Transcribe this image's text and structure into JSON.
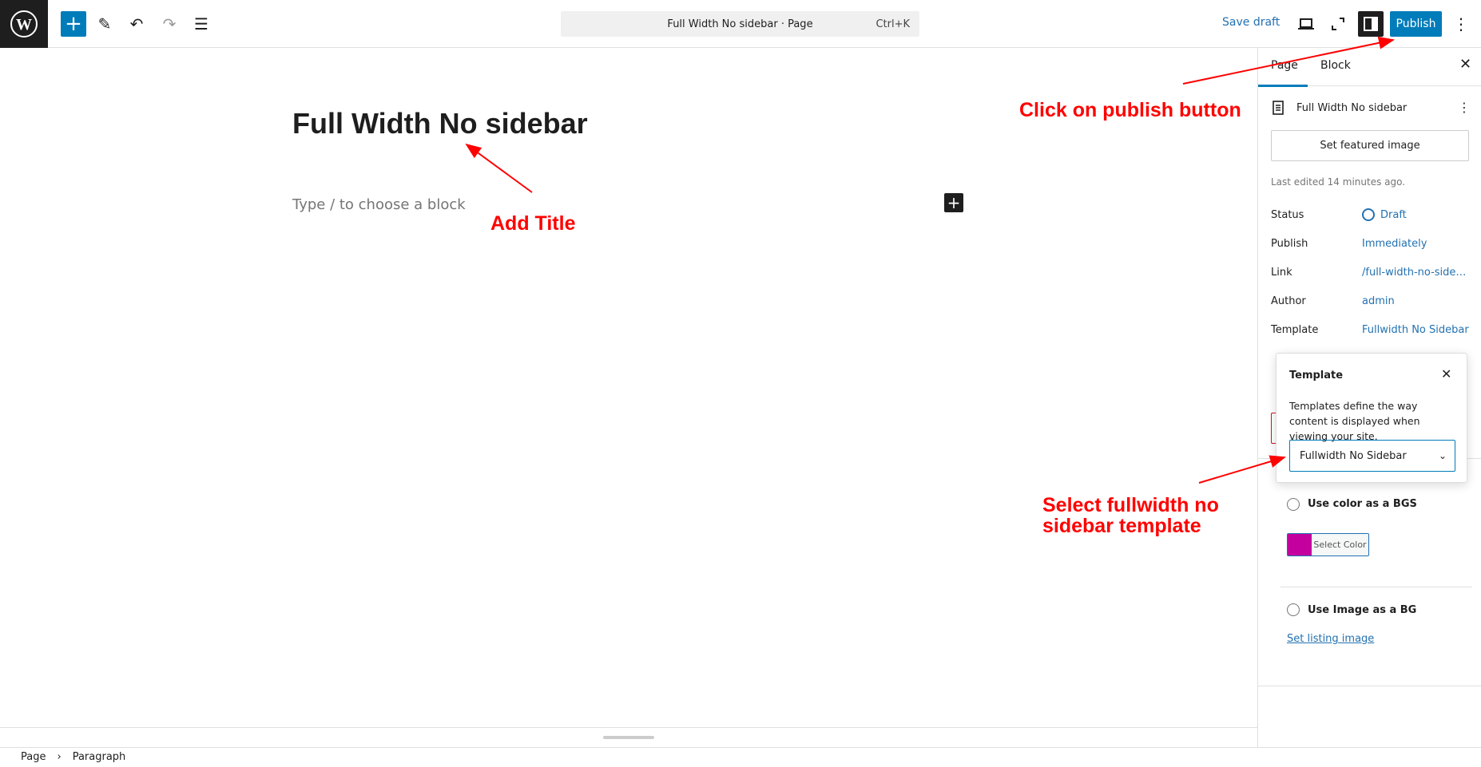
{
  "toolbar": {
    "command_bar": "Full Width No sidebar · Page",
    "shortcut": "Ctrl+K",
    "save_draft": "Save draft",
    "publish": "Publish"
  },
  "editor": {
    "title": "Full Width No sidebar",
    "placeholder": "Type / to choose a block"
  },
  "sidebar": {
    "tabs": [
      "Page",
      "Block"
    ],
    "page_title": "Full Width No sidebar",
    "featured_image": "Set featured image",
    "last_edited": "Last edited 14 minutes ago.",
    "rows": [
      {
        "label": "Status",
        "value": "Draft"
      },
      {
        "label": "Publish",
        "value": "Immediately"
      },
      {
        "label": "Link",
        "value": "/full-width-no-side…"
      },
      {
        "label": "Author",
        "value": "admin"
      },
      {
        "label": "Template",
        "value": "Fullwidth No Sidebar"
      }
    ],
    "popover": {
      "title": "Template",
      "description": "Templates define the way content is displayed when viewing your site.",
      "selected": "Fullwidth No Sidebar"
    },
    "bg_color": {
      "label": "Use color as a BGS",
      "button": "Select Color",
      "color": "#c4009e"
    },
    "bg_image": {
      "label": "Use Image as a BG",
      "link": "Set listing image"
    }
  },
  "annotations": {
    "publish": "Click on publish button",
    "title": "Add Title",
    "template": "Select fullwidth no sidebar template"
  },
  "breadcrumb": [
    "Page",
    "Paragraph"
  ]
}
